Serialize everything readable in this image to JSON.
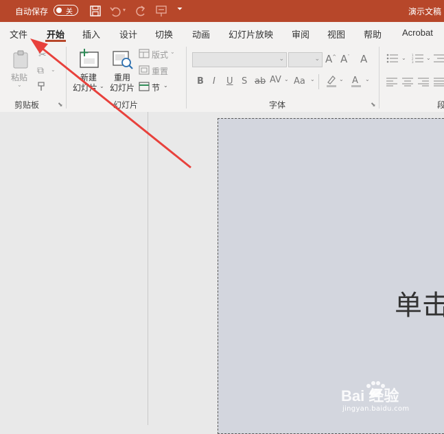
{
  "titlebar": {
    "autosave_label": "自动保存",
    "autosave_state": "关",
    "doc_title": "演示文稿"
  },
  "tabs": [
    {
      "label": "文件"
    },
    {
      "label": "开始"
    },
    {
      "label": "插入"
    },
    {
      "label": "设计"
    },
    {
      "label": "切换"
    },
    {
      "label": "动画"
    },
    {
      "label": "幻灯片放映"
    },
    {
      "label": "审阅"
    },
    {
      "label": "视图"
    },
    {
      "label": "帮助"
    },
    {
      "label": "Acrobat"
    }
  ],
  "ribbon": {
    "clipboard": {
      "paste_label": "粘贴",
      "group_label": "剪贴板"
    },
    "slides": {
      "new_slide_line1": "新建",
      "new_slide_line2": "幻灯片",
      "reuse_line1": "重用",
      "reuse_line2": "幻灯片",
      "layout_label": "版式",
      "reset_label": "重置",
      "section_label": "节",
      "group_label": "幻灯片"
    },
    "font": {
      "bold": "B",
      "italic": "I",
      "underline": "U",
      "shadow": "S",
      "strike": "ab",
      "spacing": "AV",
      "case": "Aa",
      "group_label": "字体"
    },
    "paragraph": {
      "group_label_partial": "段"
    }
  },
  "slide": {
    "title_placeholder_visible": "单击"
  },
  "watermark": {
    "brand": "Bai 经验",
    "url": "jingyan.baidu.com"
  },
  "colors": {
    "accent": "#b7472a",
    "annotation_arrow": "#e8413c"
  }
}
